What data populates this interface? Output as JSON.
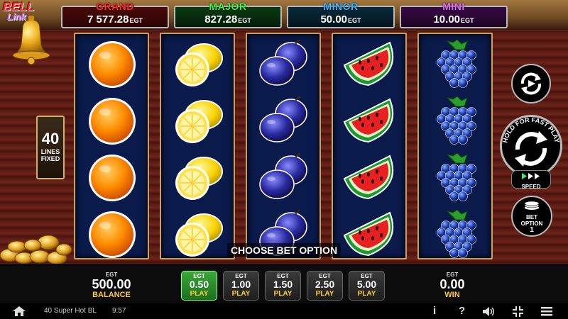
{
  "logo": {
    "line1": "BELL",
    "line2": "Link"
  },
  "jackpots": [
    {
      "label": "GRAND",
      "value": "7 577.28",
      "currency": "EGT"
    },
    {
      "label": "MAJOR",
      "value": "827.28",
      "currency": "EGT"
    },
    {
      "label": "MINOR",
      "value": "50.00",
      "currency": "EGT"
    },
    {
      "label": "MINI",
      "value": "10.00",
      "currency": "EGT"
    }
  ],
  "lines": {
    "count": "40",
    "line1": "LINES",
    "line2": "FIXED"
  },
  "reels": [
    {
      "symbol": "orange",
      "icon": "orange-icon"
    },
    {
      "symbol": "lemon",
      "icon": "lemon-icon"
    },
    {
      "symbol": "plum",
      "icon": "plum-icon"
    },
    {
      "symbol": "watermelon",
      "icon": "watermelon-icon"
    },
    {
      "symbol": "grapes",
      "icon": "grapes-icon"
    }
  ],
  "prompt": "CHOOSE BET OPTION",
  "balance": {
    "currency": "EGT",
    "amount": "500.00",
    "label": "BALANCE"
  },
  "win": {
    "currency": "EGT",
    "amount": "0.00",
    "label": "WIN"
  },
  "bets": [
    {
      "currency": "EGT",
      "amount": "0.50",
      "label": "PLAY",
      "active": true
    },
    {
      "currency": "EGT",
      "amount": "1.00",
      "label": "PLAY",
      "active": false
    },
    {
      "currency": "EGT",
      "amount": "1.50",
      "label": "PLAY",
      "active": false
    },
    {
      "currency": "EGT",
      "amount": "2.50",
      "label": "PLAY",
      "active": false
    },
    {
      "currency": "EGT",
      "amount": "5.00",
      "label": "PLAY",
      "active": false
    }
  ],
  "controls": {
    "spin_caption": "HOLD FOR FAST PLAY",
    "speed_label": "SPEED",
    "bet_option_line1": "BET",
    "bet_option_line2": "OPTION",
    "bet_option_value": "1"
  },
  "footer": {
    "game_name": "40 Super Hot BL",
    "time": "9:57",
    "info_icon": "i",
    "help_icon": "?"
  }
}
